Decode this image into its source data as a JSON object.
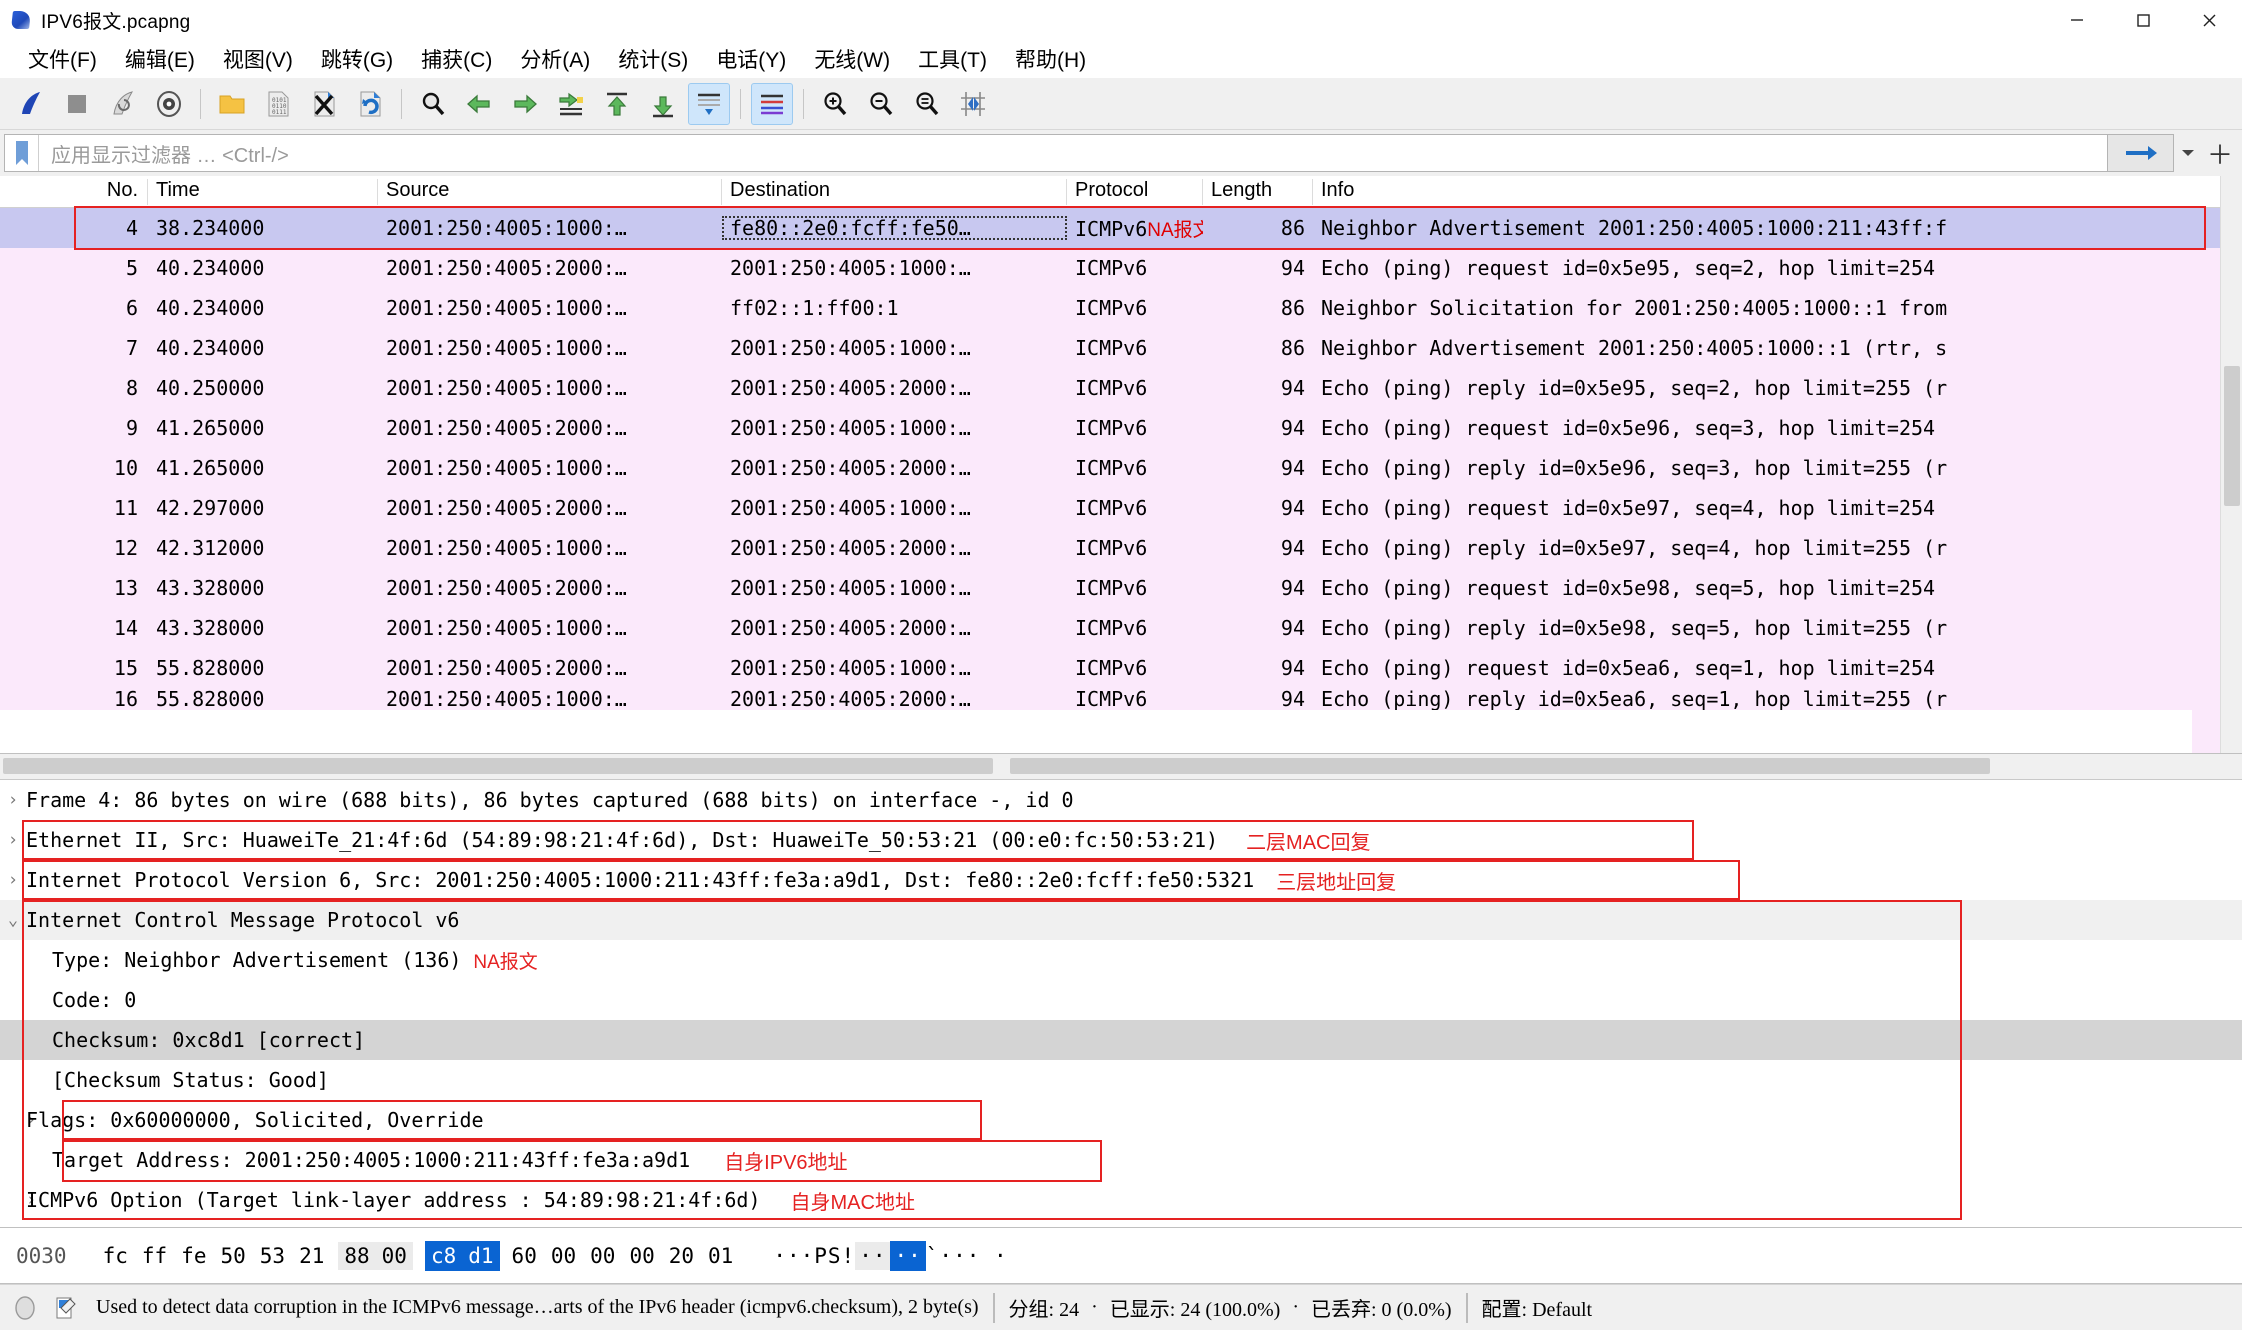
{
  "window": {
    "title": "IPV6报文.pcapng",
    "minimize": "—",
    "maximize": "▢",
    "close": "✕"
  },
  "menu": [
    {
      "label": "文件(F)"
    },
    {
      "label": "编辑(E)"
    },
    {
      "label": "视图(V)"
    },
    {
      "label": "跳转(G)"
    },
    {
      "label": "捕获(C)"
    },
    {
      "label": "分析(A)"
    },
    {
      "label": "统计(S)"
    },
    {
      "label": "电话(Y)"
    },
    {
      "label": "无线(W)"
    },
    {
      "label": "工具(T)"
    },
    {
      "label": "帮助(H)"
    }
  ],
  "toolbar": {
    "icons": [
      "start-capture-icon",
      "stop-capture-icon",
      "restart-capture-icon",
      "capture-options-icon",
      "open-file-icon",
      "save-file-icon",
      "close-file-icon",
      "reload-file-icon",
      "find-packet-icon",
      "go-back-icon",
      "go-forward-icon",
      "go-to-packet-icon",
      "go-first-packet-icon",
      "go-last-packet-icon",
      "auto-scroll-icon",
      "colorize-icon",
      "zoom-in-icon",
      "zoom-out-icon",
      "zoom-reset-icon",
      "resize-columns-icon"
    ]
  },
  "filter": {
    "placeholder": "应用显示过滤器 … <Ctrl-/>",
    "value": "",
    "apply_label": "➡",
    "dropdown_label": "▾",
    "add_label": "＋"
  },
  "packet_list": {
    "columns": [
      "No.",
      "Time",
      "Source",
      "Destination",
      "Protocol",
      "Length",
      "Info"
    ],
    "rows": [
      {
        "no": "4",
        "time": "38.234000",
        "src": "2001:250:4005:1000:…",
        "dst": "fe80::2e0:fcff:fe50…",
        "proto": "ICMPv6",
        "proto_note": "NA报文",
        "len": "86",
        "info": "Neighbor Advertisement 2001:250:4005:1000:211:43ff:f",
        "selected": true
      },
      {
        "no": "5",
        "time": "40.234000",
        "src": "2001:250:4005:2000:…",
        "dst": "2001:250:4005:1000:…",
        "proto": "ICMPv6",
        "len": "94",
        "info": "Echo (ping) request id=0x5e95, seq=2, hop limit=254"
      },
      {
        "no": "6",
        "time": "40.234000",
        "src": "2001:250:4005:1000:…",
        "dst": "ff02::1:ff00:1",
        "proto": "ICMPv6",
        "len": "86",
        "info": "Neighbor Solicitation for 2001:250:4005:1000::1 from"
      },
      {
        "no": "7",
        "time": "40.234000",
        "src": "2001:250:4005:1000:…",
        "dst": "2001:250:4005:1000:…",
        "proto": "ICMPv6",
        "len": "86",
        "info": "Neighbor Advertisement 2001:250:4005:1000::1 (rtr, s"
      },
      {
        "no": "8",
        "time": "40.250000",
        "src": "2001:250:4005:1000:…",
        "dst": "2001:250:4005:2000:…",
        "proto": "ICMPv6",
        "len": "94",
        "info": "Echo (ping) reply id=0x5e95, seq=2, hop limit=255 (r"
      },
      {
        "no": "9",
        "time": "41.265000",
        "src": "2001:250:4005:2000:…",
        "dst": "2001:250:4005:1000:…",
        "proto": "ICMPv6",
        "len": "94",
        "info": "Echo (ping) request id=0x5e96, seq=3, hop limit=254"
      },
      {
        "no": "10",
        "time": "41.265000",
        "src": "2001:250:4005:1000:…",
        "dst": "2001:250:4005:2000:…",
        "proto": "ICMPv6",
        "len": "94",
        "info": "Echo (ping) reply id=0x5e96, seq=3, hop limit=255 (r"
      },
      {
        "no": "11",
        "time": "42.297000",
        "src": "2001:250:4005:2000:…",
        "dst": "2001:250:4005:1000:…",
        "proto": "ICMPv6",
        "len": "94",
        "info": "Echo (ping) request id=0x5e97, seq=4, hop limit=254"
      },
      {
        "no": "12",
        "time": "42.312000",
        "src": "2001:250:4005:1000:…",
        "dst": "2001:250:4005:2000:…",
        "proto": "ICMPv6",
        "len": "94",
        "info": "Echo (ping) reply id=0x5e97, seq=4, hop limit=255 (r"
      },
      {
        "no": "13",
        "time": "43.328000",
        "src": "2001:250:4005:2000:…",
        "dst": "2001:250:4005:1000:…",
        "proto": "ICMPv6",
        "len": "94",
        "info": "Echo (ping) request id=0x5e98, seq=5, hop limit=254"
      },
      {
        "no": "14",
        "time": "43.328000",
        "src": "2001:250:4005:1000:…",
        "dst": "2001:250:4005:2000:…",
        "proto": "ICMPv6",
        "len": "94",
        "info": "Echo (ping) reply id=0x5e98, seq=5, hop limit=255 (r"
      },
      {
        "no": "15",
        "time": "55.828000",
        "src": "2001:250:4005:2000:…",
        "dst": "2001:250:4005:1000:…",
        "proto": "ICMPv6",
        "len": "94",
        "info": "Echo (ping) request id=0x5ea6, seq=1, hop limit=254"
      },
      {
        "no": "16",
        "time": "55.828000",
        "src": "2001:250:4005:1000:…",
        "dst": "2001:250:4005:2000:…",
        "proto": "ICMPv6",
        "len": "94",
        "info": "Echo (ping) reply id=0x5ea6, seq=1, hop limit=255 (r"
      }
    ]
  },
  "detail": {
    "lines": [
      {
        "text": "Frame 4: 86 bytes on wire (688 bits), 86 bytes captured (688 bits) on interface -, id 0",
        "twisty": "›",
        "indent": 1
      },
      {
        "text": "Ethernet II, Src: HuaweiTe_21:4f:6d (54:89:98:21:4f:6d), Dst: HuaweiTe_50:53:21 (00:e0:fc:50:53:21)",
        "twisty": "›",
        "indent": 1,
        "annotation": "二层MAC回复",
        "boxed": true
      },
      {
        "text": "Internet Protocol Version 6, Src: 2001:250:4005:1000:211:43ff:fe3a:a9d1, Dst: fe80::2e0:fcff:fe50:5321",
        "twisty": "›",
        "indent": 1,
        "annotation": "三层地址回复",
        "boxed": true
      },
      {
        "text": "Internet Control Message Protocol v6",
        "twisty": "⌄",
        "indent": 1,
        "hl": "light"
      },
      {
        "text": "Type: Neighbor Advertisement (136)",
        "twisty": "",
        "indent": 2,
        "annotation": "NA报文"
      },
      {
        "text": "Code: 0",
        "twisty": "",
        "indent": 2
      },
      {
        "text": "Checksum: 0xc8d1 [correct]",
        "twisty": "",
        "indent": 2,
        "hl": "dark"
      },
      {
        "text": "[Checksum Status: Good]",
        "twisty": "",
        "indent": 2
      },
      {
        "text": "Flags: 0x60000000, Solicited, Override",
        "twisty": "›",
        "indent": 2
      },
      {
        "text": "Target Address: 2001:250:4005:1000:211:43ff:fe3a:a9d1",
        "twisty": "",
        "indent": 2,
        "annotation": "自身IPV6地址",
        "boxed": true
      },
      {
        "text": "ICMPv6 Option (Target link-layer address : 54:89:98:21:4f:6d)",
        "twisty": "›",
        "indent": 2,
        "annotation": "自身MAC地址",
        "boxed": true
      }
    ]
  },
  "hex": {
    "offset": "0030",
    "bytes": [
      {
        "v": "fc",
        "style": "plain"
      },
      {
        "v": "ff",
        "style": "plain"
      },
      {
        "v": "fe",
        "style": "plain"
      },
      {
        "v": "50",
        "style": "plain"
      },
      {
        "v": "53",
        "style": "plain"
      },
      {
        "v": "21",
        "style": "plain"
      },
      {
        "v": "88",
        "style": "grey"
      },
      {
        "v": "00",
        "style": "grey"
      },
      {
        "v": "c8",
        "style": "selected"
      },
      {
        "v": "d1",
        "style": "selected"
      },
      {
        "v": "60",
        "style": "plain"
      },
      {
        "v": "00",
        "style": "plain"
      },
      {
        "v": "00",
        "style": "plain"
      },
      {
        "v": "00",
        "style": "plain"
      },
      {
        "v": "20",
        "style": "plain"
      },
      {
        "v": "01",
        "style": "plain"
      }
    ],
    "ascii_segments": [
      {
        "t": "···PS!",
        "style": "plain"
      },
      {
        "t": "··",
        "style": "grey"
      },
      {
        "t": "··",
        "style": "selected"
      },
      {
        "t": "`··· ·",
        "style": "plain"
      }
    ]
  },
  "status": {
    "expert_icon": "expert-info-icon",
    "capture_file_icon": "capture-file-properties-icon",
    "field_help": "Used to detect data corruption in the ICMPv6 message…arts of the IPv6 header (icmpv6.checksum), 2 byte(s)",
    "packets": "分组: 24",
    "dot1": "·",
    "displayed": "已显示: 24 (100.0%)",
    "dot2": "·",
    "dropped": "已丢弃: 0 (0.0%)",
    "profile": "配置: Default"
  },
  "colors": {
    "selected_row": "#c8c8f0",
    "icmpv6_row": "#fbe9fb",
    "annotation_red": "#e52222",
    "hex_selection_blue": "#0a64d2"
  }
}
